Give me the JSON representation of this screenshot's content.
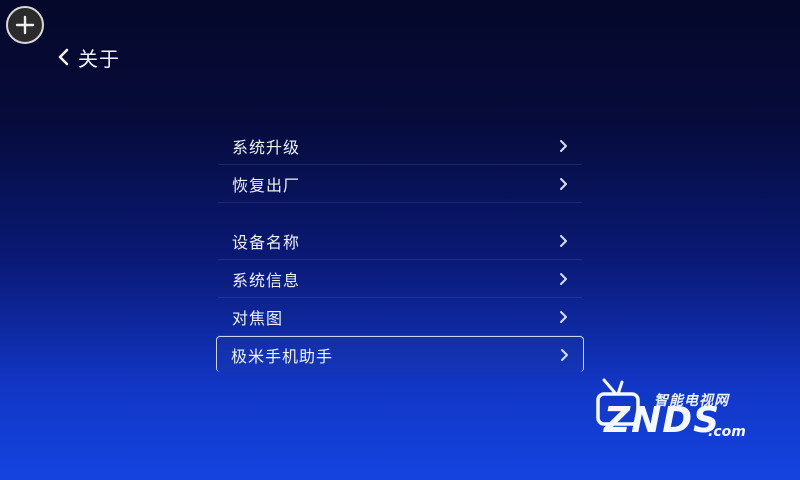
{
  "header": {
    "title": "关于"
  },
  "menu": {
    "groups": [
      {
        "items": [
          {
            "label": "系统升级"
          },
          {
            "label": "恢复出厂"
          }
        ]
      },
      {
        "items": [
          {
            "label": "设备名称"
          },
          {
            "label": "系统信息"
          },
          {
            "label": "对焦图"
          },
          {
            "label": "极米手机助手"
          }
        ]
      }
    ],
    "selected": "极米手机助手"
  },
  "watermark": {
    "cn": "智能电视网",
    "en": "ZNDS",
    "domain": ".com"
  },
  "icons": {
    "add": "plus-circle-icon",
    "back": "chevron-left-icon",
    "item": "chevron-right-icon"
  },
  "colors": {
    "bg_top": "#05082a",
    "bg_bottom": "#1444e0",
    "selection_border": "#c9d4f2"
  }
}
